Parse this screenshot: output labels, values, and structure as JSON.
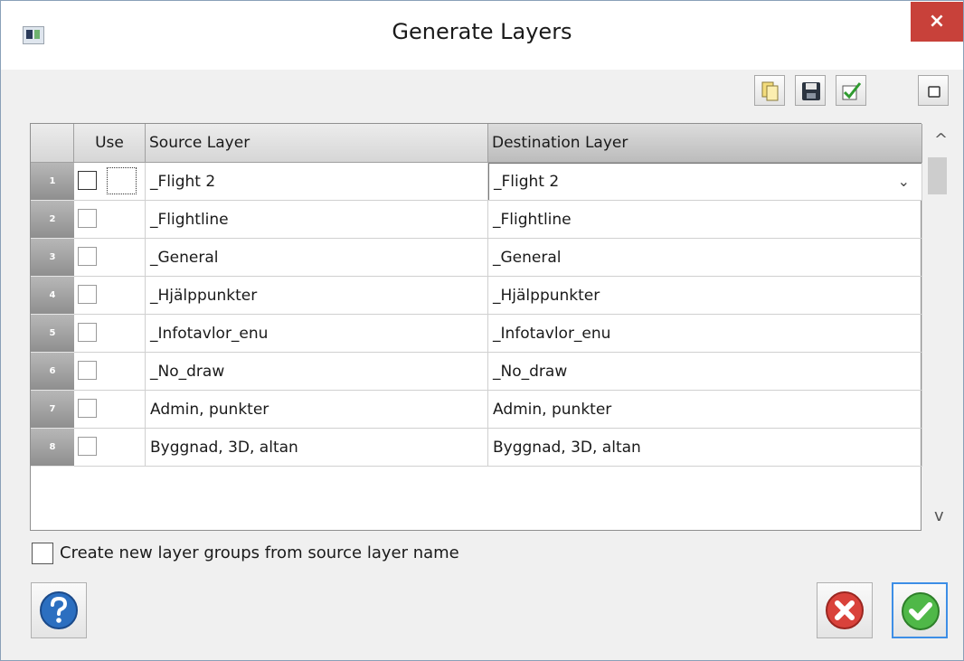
{
  "window": {
    "title": "Generate Layers",
    "close_glyph": "×",
    "app_icon": "app-window-icon"
  },
  "toolbar": {
    "buttons": [
      {
        "name": "open-file-button",
        "icon": "open-file-icon"
      },
      {
        "name": "save-button",
        "icon": "save-icon"
      },
      {
        "name": "check-all-button",
        "icon": "check-all-icon"
      },
      {
        "name": "uncheck-all-button",
        "icon": "uncheck-all-icon"
      }
    ]
  },
  "grid": {
    "headers": {
      "use": "Use",
      "source": "Source Layer",
      "destination": "Destination Layer"
    },
    "rows": [
      {
        "num": "1",
        "use": false,
        "source": "_Flight 2",
        "destination": "_Flight 2",
        "editing": true
      },
      {
        "num": "2",
        "use": false,
        "source": "_Flightline",
        "destination": "_Flightline"
      },
      {
        "num": "3",
        "use": false,
        "source": "_General",
        "destination": "_General"
      },
      {
        "num": "4",
        "use": false,
        "source": "_Hjälppunkter",
        "destination": "_Hjälppunkter"
      },
      {
        "num": "5",
        "use": false,
        "source": "_Infotavlor_enu",
        "destination": "_Infotavlor_enu"
      },
      {
        "num": "6",
        "use": false,
        "source": "_No_draw",
        "destination": "_No_draw"
      },
      {
        "num": "7",
        "use": false,
        "source": "Admin, punkter",
        "destination": "Admin, punkter"
      },
      {
        "num": "8",
        "use": false,
        "source": "Byggnad, 3D, altan",
        "destination": "Byggnad, 3D, altan"
      }
    ],
    "scroll_up": "^",
    "scroll_down": "v",
    "dropdown_arrow": "⌄"
  },
  "options": {
    "create_groups_label": "Create new layer groups from source layer name",
    "create_groups_checked": false
  },
  "footer": {
    "help_icon": "help-icon",
    "cancel_icon": "cancel-icon",
    "ok_icon": "ok-icon"
  },
  "colors": {
    "close": "#c8413a",
    "cancel": "#d9423b",
    "ok": "#4fb848",
    "help": "#2c6fc0"
  }
}
